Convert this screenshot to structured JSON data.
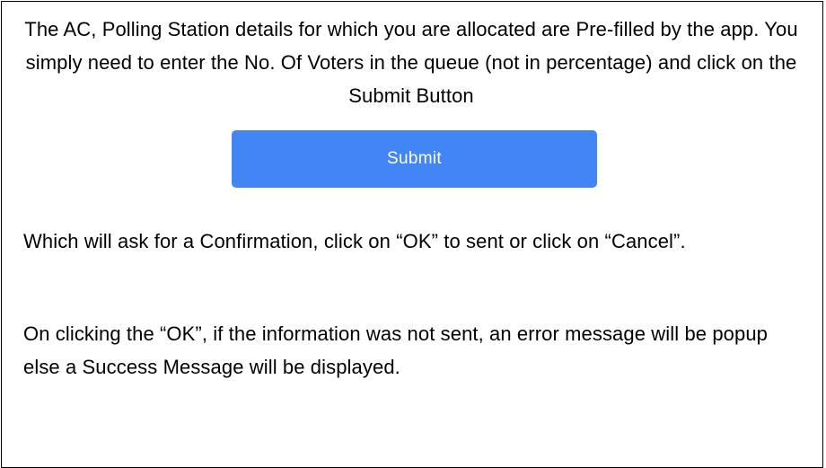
{
  "intro_text": "The AC, Polling Station details for which you are allocated are Pre-filled by the app. You simply need to enter the No. Of Voters in the queue (not in percentage) and click on the Submit Button",
  "submit_button": {
    "label": "Submit",
    "color": "#4285f4"
  },
  "confirm_text": "Which will ask for a Confirmation, click on “OK” to sent or click on “Cancel”.",
  "result_text": "On clicking the “OK”, if the information was not sent, an error message will be popup else a Success Message will be displayed."
}
